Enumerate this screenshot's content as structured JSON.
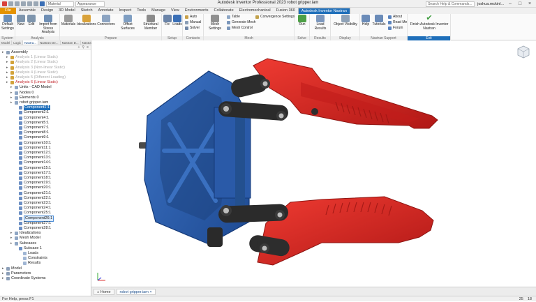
{
  "titlebar": {
    "title": "Autodesk Inventor Professional 2023   robot gripper.iam",
    "material_label": "Material",
    "appearance_label": "Appearance",
    "search_placeholder": "Search Help & Commands...",
    "user": "joshua.mckinl..."
  },
  "tabs": [
    {
      "label": "File"
    },
    {
      "label": "Assemble"
    },
    {
      "label": "Design"
    },
    {
      "label": "3D Model"
    },
    {
      "label": "Sketch"
    },
    {
      "label": "Annotate"
    },
    {
      "label": "Inspect"
    },
    {
      "label": "Tools"
    },
    {
      "label": "Manage"
    },
    {
      "label": "View"
    },
    {
      "label": "Environments"
    },
    {
      "label": "Collaborate"
    },
    {
      "label": "Electromechanical"
    },
    {
      "label": "Fusion 360"
    },
    {
      "label": "Autodesk Inventor Nastran"
    }
  ],
  "ribbon": {
    "system": {
      "title": "System",
      "default_settings": "Default Settings"
    },
    "analysis": {
      "title": "Analysis",
      "new": "New",
      "edit": "Edit",
      "import": "Import from Stress Analysis"
    },
    "prepare": {
      "title": "Prepare",
      "materials": "Materials",
      "idealizations": "Idealizations",
      "connectors": "Connectors",
      "offset_surfaces": "Offset Surfaces",
      "structural_member": "Structural Member"
    },
    "setup": {
      "title": "Setup",
      "fix": "Fix",
      "loads": "Loads"
    },
    "contacts": {
      "title": "Contacts",
      "auto": "Auto",
      "manual": "Manual",
      "solver": "Solver"
    },
    "mesh": {
      "title": "Mesh",
      "mesh_settings": "Mesh Settings",
      "table": "Table",
      "generate_mesh": "Generate Mesh",
      "mesh_control": "Mesh Control",
      "convergence": "Convergence Settings"
    },
    "solve": {
      "title": "Solve",
      "run": "Run"
    },
    "results": {
      "title": "Results",
      "load_results": "Load Results"
    },
    "display": {
      "title": "Display",
      "object_visibility": "Object Visibility"
    },
    "support": {
      "title": "Nastran Support",
      "help": "Help",
      "tutorials": "Tutorials",
      "about": "About",
      "read_me": "Read Me",
      "forum": "Forum"
    },
    "exit": {
      "title": "Exit",
      "finish": "Finish Autodesk Inventor Nastran"
    }
  },
  "browser": {
    "tabs": [
      "Model",
      "Logic",
      "Nastra...",
      "Nastran De...",
      "Nastran D...",
      "Nastran D..."
    ],
    "tree": [
      {
        "label": "Assembly",
        "indent": 0,
        "style": ""
      },
      {
        "label": "Analysis 1 (Linear Static)",
        "indent": 1,
        "style": "faded"
      },
      {
        "label": "Analysis 2 (Linear Static)",
        "indent": 1,
        "style": "faded"
      },
      {
        "label": "Analysis 3 (Non-linear Static)",
        "indent": 1,
        "style": "faded"
      },
      {
        "label": "Analysis 4 (Linear Static)",
        "indent": 1,
        "style": "faded"
      },
      {
        "label": "Analysis 5 (Different Loading)",
        "indent": 1,
        "style": "faded"
      },
      {
        "label": "Analysis 6 (Linear Static)",
        "indent": 1,
        "style": "red"
      },
      {
        "label": "Units - CAD Model",
        "indent": 2,
        "style": ""
      },
      {
        "label": "Nodes 0",
        "indent": 2,
        "style": ""
      },
      {
        "label": "Elements 0",
        "indent": 2,
        "style": ""
      },
      {
        "label": "robot gripper.iam",
        "indent": 2,
        "style": ""
      },
      {
        "label": "Component1:1",
        "indent": 3,
        "style": "sel"
      },
      {
        "label": "Component2:1",
        "indent": 3,
        "style": ""
      },
      {
        "label": "Component4:1",
        "indent": 3,
        "style": ""
      },
      {
        "label": "Component5:1",
        "indent": 3,
        "style": ""
      },
      {
        "label": "Component7:1",
        "indent": 3,
        "style": ""
      },
      {
        "label": "Component8:1",
        "indent": 3,
        "style": ""
      },
      {
        "label": "Component9:1",
        "indent": 3,
        "style": ""
      },
      {
        "label": "Component10:1",
        "indent": 3,
        "style": ""
      },
      {
        "label": "Component11:1",
        "indent": 3,
        "style": ""
      },
      {
        "label": "Component12:1",
        "indent": 3,
        "style": ""
      },
      {
        "label": "Component13:1",
        "indent": 3,
        "style": ""
      },
      {
        "label": "Component14:1",
        "indent": 3,
        "style": ""
      },
      {
        "label": "Component15:1",
        "indent": 3,
        "style": ""
      },
      {
        "label": "Component17:1",
        "indent": 3,
        "style": ""
      },
      {
        "label": "Component18:1",
        "indent": 3,
        "style": ""
      },
      {
        "label": "Component19:1",
        "indent": 3,
        "style": ""
      },
      {
        "label": "Component20:1",
        "indent": 3,
        "style": ""
      },
      {
        "label": "Component21:1",
        "indent": 3,
        "style": ""
      },
      {
        "label": "Component22:1",
        "indent": 3,
        "style": ""
      },
      {
        "label": "Component23:1",
        "indent": 3,
        "style": ""
      },
      {
        "label": "Component24:1",
        "indent": 3,
        "style": ""
      },
      {
        "label": "Component25:1",
        "indent": 3,
        "style": ""
      },
      {
        "label": "Component26:1",
        "indent": 3,
        "style": "hov"
      },
      {
        "label": "Component27:1",
        "indent": 3,
        "style": ""
      },
      {
        "label": "Component28:1",
        "indent": 3,
        "style": ""
      },
      {
        "label": "Idealizations",
        "indent": 2,
        "style": ""
      },
      {
        "label": "Mesh Model",
        "indent": 2,
        "style": ""
      },
      {
        "label": "Subcases",
        "indent": 2,
        "style": ""
      },
      {
        "label": "Subcase 1",
        "indent": 3,
        "style": ""
      },
      {
        "label": "Loads",
        "indent": 4,
        "style": ""
      },
      {
        "label": "Constraints",
        "indent": 4,
        "style": ""
      },
      {
        "label": "Results",
        "indent": 4,
        "style": ""
      },
      {
        "label": "Model",
        "indent": 0,
        "style": ""
      },
      {
        "label": "Parameters",
        "indent": 0,
        "style": ""
      },
      {
        "label": "Coordinate Systems",
        "indent": 0,
        "style": ""
      }
    ]
  },
  "doc_tabs": {
    "home": "Home",
    "active": "robot gripper.iam"
  },
  "status": {
    "text": "For Help, press F1",
    "n1": "25",
    "n2": "18"
  },
  "colors": {
    "accent": "#1f6fba",
    "file_tab": "#e59300",
    "blue_part": "#2b5cab",
    "red_part": "#d3211f",
    "dark_part": "#2d2d2d"
  }
}
